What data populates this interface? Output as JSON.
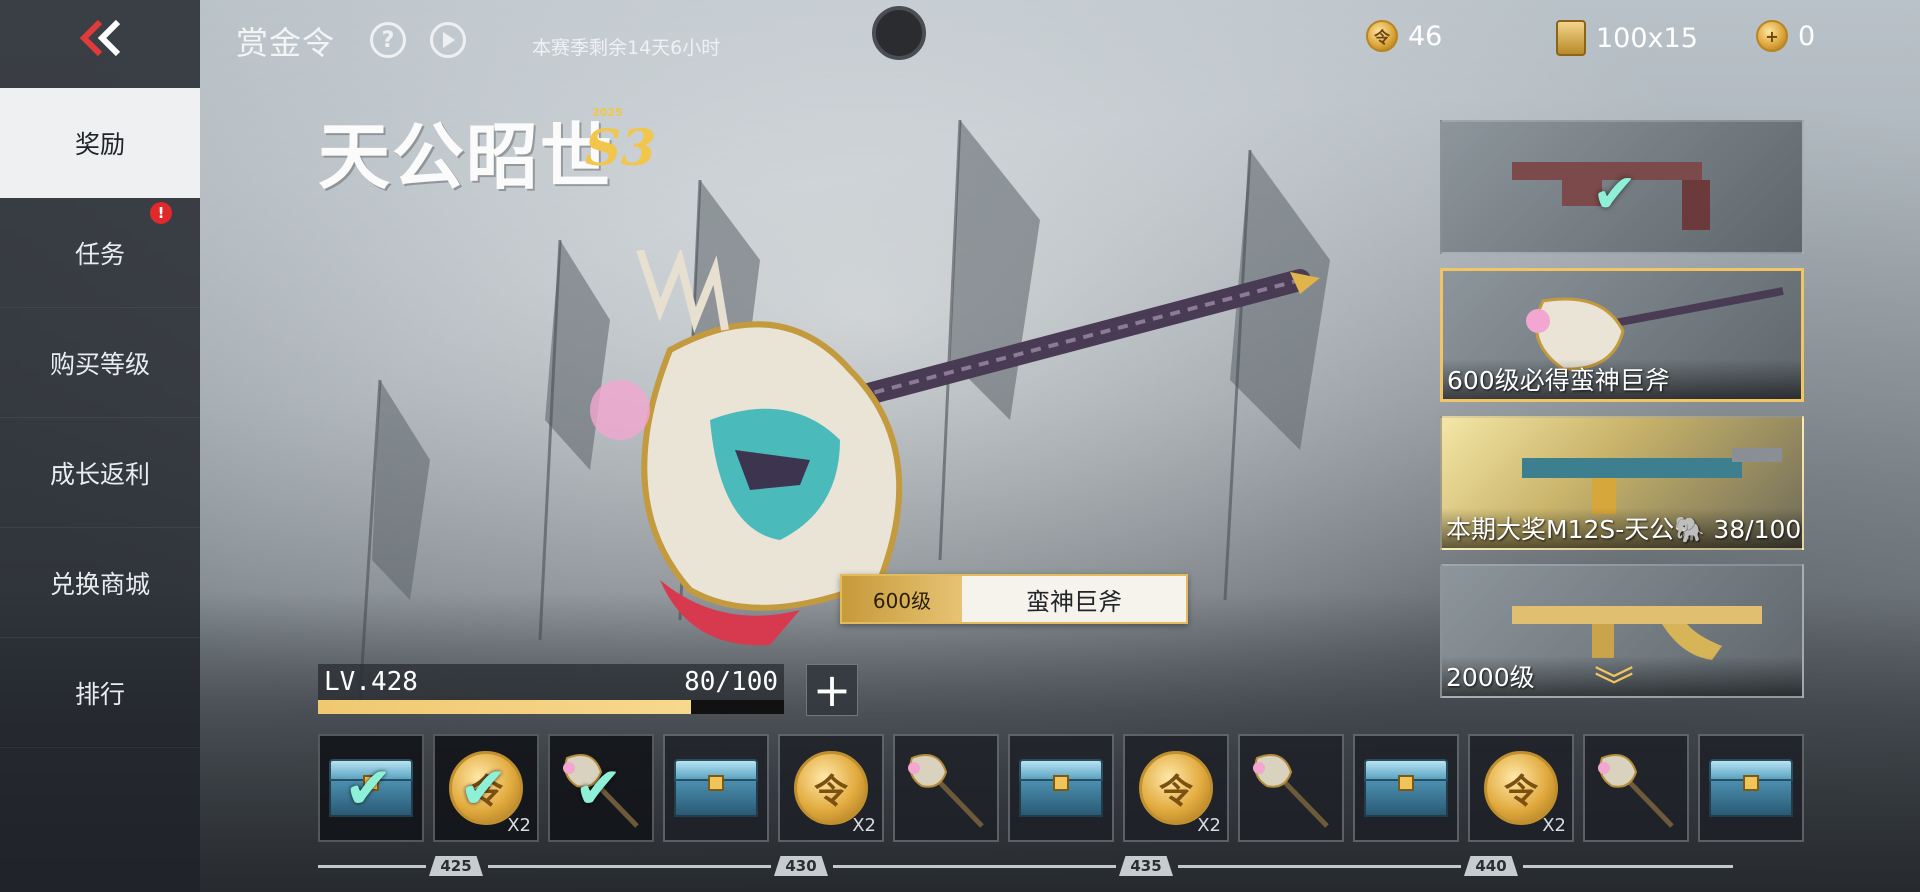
{
  "header": {
    "title": "赏金令",
    "help_icon": "question-circle-icon",
    "play_icon": "play-circle-icon",
    "season_remaining": "本赛季剩余14天6小时"
  },
  "currencies": [
    {
      "icon": "gold-coin-icon",
      "value": "46"
    },
    {
      "icon": "ticket-icon",
      "value": "100x15"
    },
    {
      "icon": "add-coin-icon",
      "value": "0"
    }
  ],
  "sidebar": {
    "back_icon": "double-chevron-left-icon",
    "items": [
      {
        "label": "奖励",
        "active": true
      },
      {
        "label": "任务",
        "badge": "!"
      },
      {
        "label": "购买等级"
      },
      {
        "label": "成长返利"
      },
      {
        "label": "兑换商城"
      },
      {
        "label": "排行"
      }
    ]
  },
  "logo": {
    "text": "天公昭世",
    "season": "S3",
    "year": "2025"
  },
  "featured_item": {
    "level": "600级",
    "name": "蛮神巨斧"
  },
  "level": {
    "label": "LV.428",
    "progress_text": "80/100",
    "progress": 0.8
  },
  "showcase": [
    {
      "label": "",
      "claimed": true
    },
    {
      "label": "600级必得蛮神巨斧",
      "selected": true
    },
    {
      "label": "本期大奖M12S-天公🐘 38/100"
    },
    {
      "label": "2000级"
    }
  ],
  "rewards": [
    {
      "type": "chest",
      "claimed": true
    },
    {
      "type": "coin",
      "qty": "X2",
      "claimed": true
    },
    {
      "type": "axe",
      "claimed": true
    },
    {
      "type": "chest"
    },
    {
      "type": "coin",
      "qty": "X2"
    },
    {
      "type": "axe"
    },
    {
      "type": "chest"
    },
    {
      "type": "coin",
      "qty": "X2"
    },
    {
      "type": "axe"
    },
    {
      "type": "chest"
    },
    {
      "type": "coin",
      "qty": "X2"
    },
    {
      "type": "axe"
    },
    {
      "type": "chest"
    }
  ],
  "level_markers": [
    "425",
    "430",
    "435",
    "440"
  ],
  "colors": {
    "accent_gold": "#f1c563",
    "check_teal": "#8ff0d8",
    "badge_red": "#e1292b"
  }
}
